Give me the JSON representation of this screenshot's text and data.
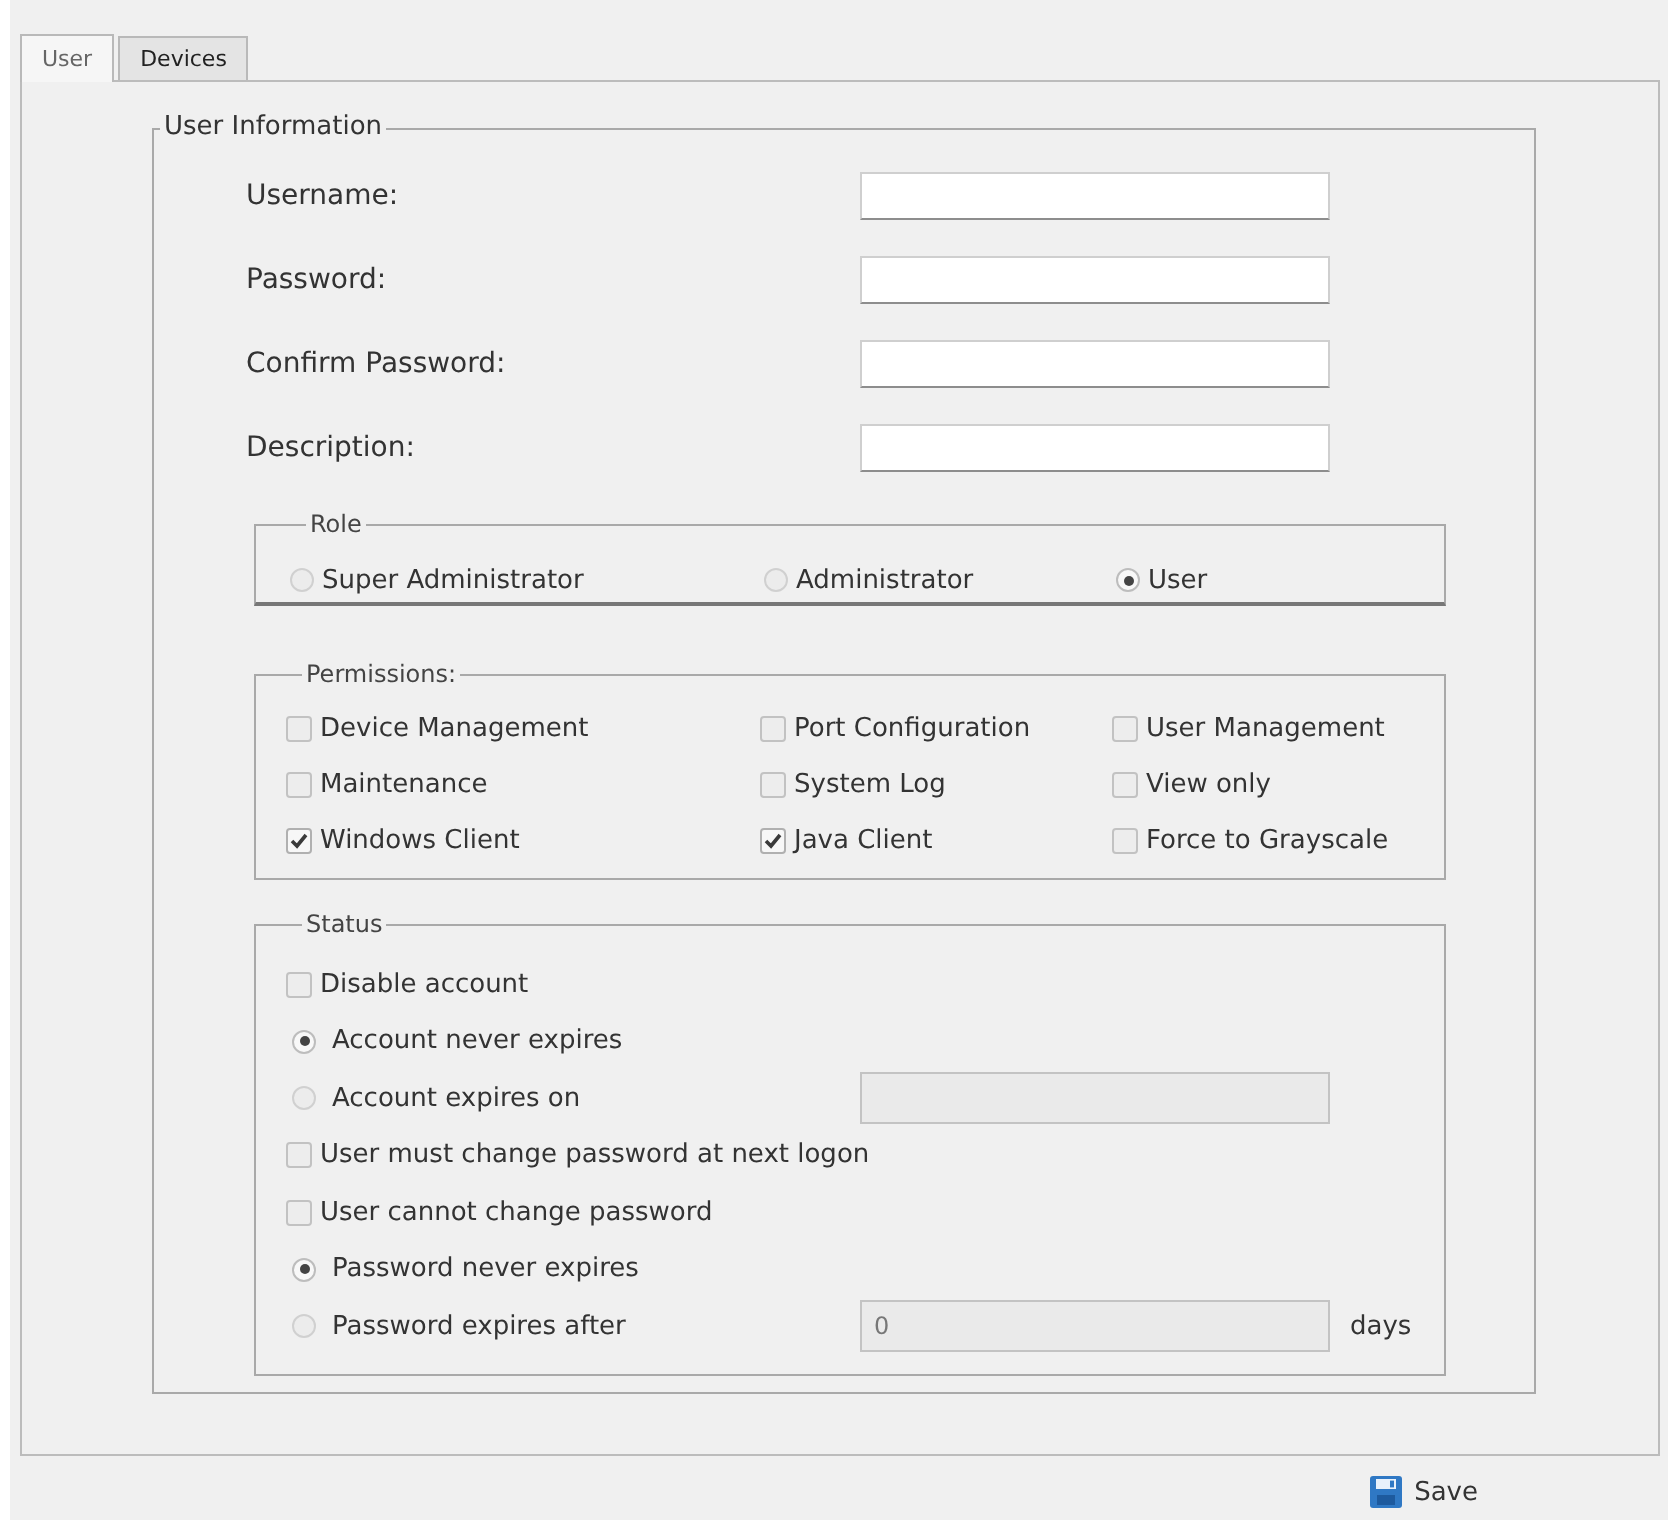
{
  "tabs": [
    {
      "label": "User",
      "selected": true
    },
    {
      "label": "Devices",
      "selected": false
    }
  ],
  "user_information": {
    "legend": "User Information",
    "fields": [
      {
        "label": "Username:"
      },
      {
        "label": "Password:"
      },
      {
        "label": "Confirm Password:"
      },
      {
        "label": "Description:"
      }
    ]
  },
  "role": {
    "legend": "Role",
    "options": [
      {
        "label": "Super Administrator",
        "selected": false
      },
      {
        "label": "Administrator",
        "selected": false
      },
      {
        "label": "User",
        "selected": true
      }
    ]
  },
  "permissions": {
    "legend": "Permissions:",
    "items": [
      {
        "label": "Device Management",
        "checked": false
      },
      {
        "label": "Port Configuration",
        "checked": false
      },
      {
        "label": "User Management",
        "checked": false
      },
      {
        "label": "Maintenance",
        "checked": false
      },
      {
        "label": "System Log",
        "checked": false
      },
      {
        "label": "View only",
        "checked": false
      },
      {
        "label": "Windows Client",
        "checked": true
      },
      {
        "label": "Java Client",
        "checked": true
      },
      {
        "label": "Force to Grayscale",
        "checked": false
      }
    ]
  },
  "status": {
    "legend": "Status",
    "items": [
      {
        "kind": "checkbox",
        "label": "Disable account",
        "checked": false
      },
      {
        "kind": "radio",
        "label": "Account never expires",
        "selected": true
      },
      {
        "kind": "radio",
        "label": "Account expires on",
        "selected": false,
        "field": {
          "disabled": true
        }
      },
      {
        "kind": "checkbox",
        "label": "User must change password at next logon",
        "checked": false
      },
      {
        "kind": "checkbox",
        "label": "User cannot change password",
        "checked": false
      },
      {
        "kind": "radio",
        "label": "Password never expires",
        "selected": true
      },
      {
        "kind": "radio",
        "label": "Password expires after",
        "selected": false,
        "field": {
          "value": "0",
          "disabled": true
        },
        "unit": "days"
      }
    ]
  },
  "save_button": {
    "label": "Save"
  }
}
